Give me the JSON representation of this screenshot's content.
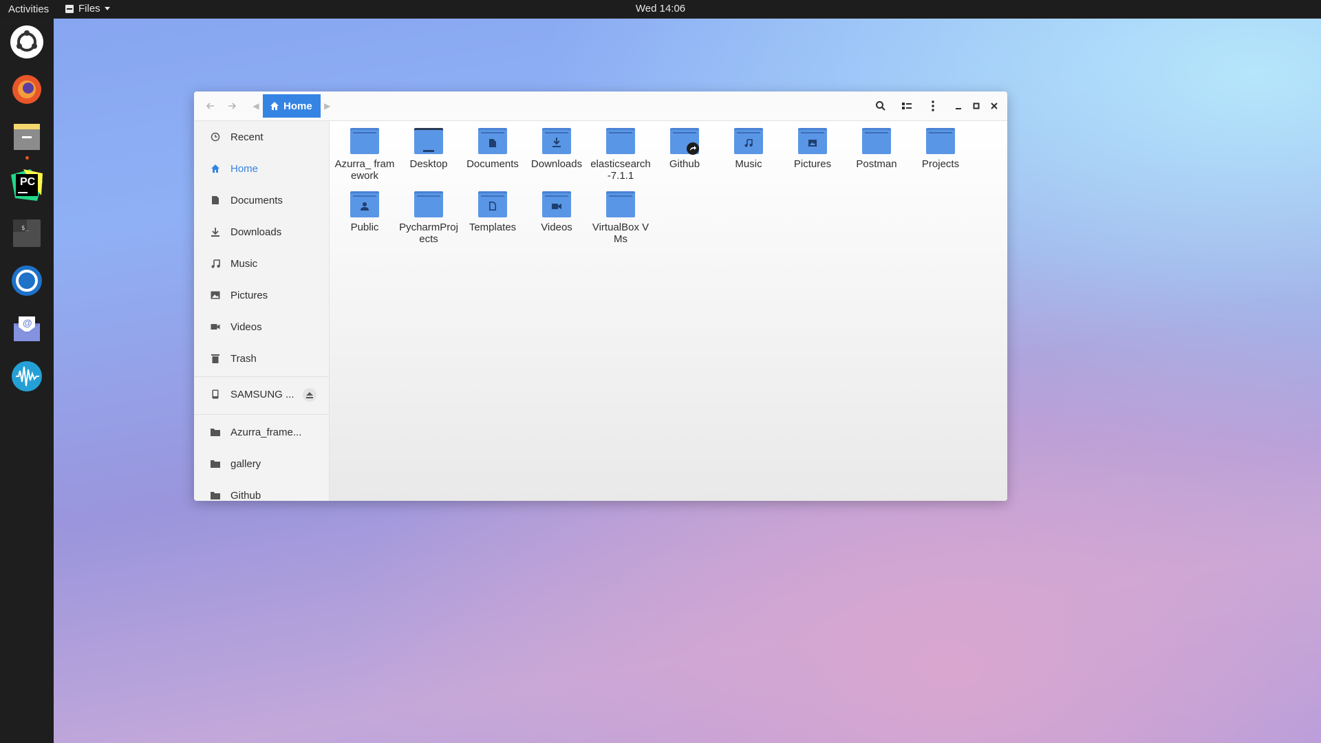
{
  "topbar": {
    "activities": "Activities",
    "app_menu": "Files",
    "clock": "Wed 14:06"
  },
  "dock": {
    "apps": [
      {
        "name": "Ubuntu Software",
        "icon": "ubuntu-icon"
      },
      {
        "name": "Firefox",
        "icon": "firefox-icon"
      },
      {
        "name": "Files",
        "icon": "files-icon",
        "running": true
      },
      {
        "name": "PyCharm",
        "icon": "pycharm-icon",
        "label": "PC"
      },
      {
        "name": "Terminal",
        "icon": "terminal-icon",
        "label": "$_"
      },
      {
        "name": "Mattermost",
        "icon": "mattermost-icon"
      },
      {
        "name": "Mail",
        "icon": "mail-icon",
        "label": "@"
      },
      {
        "name": "Audio",
        "icon": "waveform-icon"
      }
    ]
  },
  "window": {
    "path_current": "Home",
    "sidebar": {
      "places": [
        {
          "label": "Recent",
          "icon": "clock-icon"
        },
        {
          "label": "Home",
          "icon": "home-icon",
          "active": true
        },
        {
          "label": "Documents",
          "icon": "document-icon"
        },
        {
          "label": "Downloads",
          "icon": "download-icon"
        },
        {
          "label": "Music",
          "icon": "music-icon"
        },
        {
          "label": "Pictures",
          "icon": "picture-icon"
        },
        {
          "label": "Videos",
          "icon": "video-icon"
        },
        {
          "label": "Trash",
          "icon": "trash-icon"
        }
      ],
      "devices": [
        {
          "label": "SAMSUNG ...",
          "icon": "phone-icon"
        }
      ],
      "bookmarks": [
        {
          "label": "Azurra_frame...",
          "icon": "folder-icon"
        },
        {
          "label": "gallery",
          "icon": "folder-icon"
        },
        {
          "label": "Github",
          "icon": "folder-icon"
        }
      ]
    },
    "files": [
      {
        "name": "Azurra_ framework",
        "emblem": ""
      },
      {
        "name": "Desktop",
        "emblem": "desktop"
      },
      {
        "name": "Documents",
        "emblem": "doc"
      },
      {
        "name": "Downloads",
        "emblem": "down"
      },
      {
        "name": "elasticsearch-7.1.1",
        "emblem": ""
      },
      {
        "name": "Github",
        "emblem": "link"
      },
      {
        "name": "Music",
        "emblem": "music"
      },
      {
        "name": "Pictures",
        "emblem": "pic"
      },
      {
        "name": "Postman",
        "emblem": ""
      },
      {
        "name": "Projects",
        "emblem": ""
      },
      {
        "name": "Public",
        "emblem": "user"
      },
      {
        "name": "PycharmProjects",
        "emblem": ""
      },
      {
        "name": "Templates",
        "emblem": "tpl"
      },
      {
        "name": "Videos",
        "emblem": "video"
      },
      {
        "name": "VirtualBox VMs",
        "emblem": ""
      }
    ]
  }
}
